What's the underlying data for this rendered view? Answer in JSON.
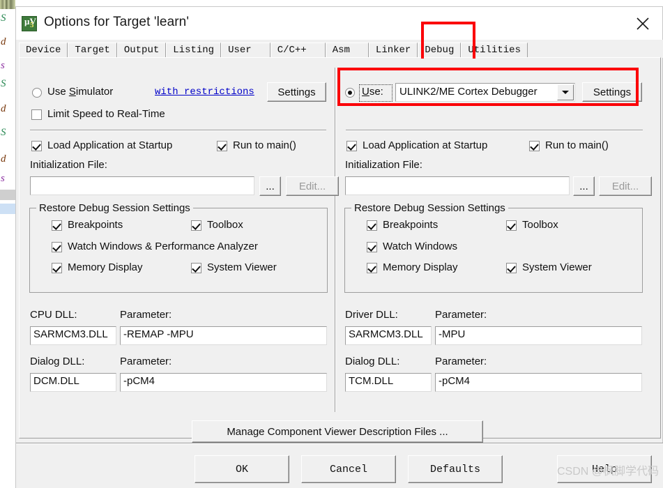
{
  "window": {
    "title": "Options for Target 'learn'",
    "app_icon": "keil-uvision-icon",
    "close_label": "✕"
  },
  "tabs": [
    {
      "label": "Device",
      "active": false
    },
    {
      "label": "Target",
      "active": false
    },
    {
      "label": "Output",
      "active": false
    },
    {
      "label": "Listing",
      "active": false
    },
    {
      "label": "User",
      "active": false
    },
    {
      "label": "C/C++",
      "active": false
    },
    {
      "label": "Asm",
      "active": false
    },
    {
      "label": "Linker",
      "active": false
    },
    {
      "label": "Debug",
      "active": true
    },
    {
      "label": "Utilities",
      "active": false
    }
  ],
  "left_panel": {
    "use_simulator": {
      "label": "Use Simulator",
      "accel": "S",
      "checked": false
    },
    "with_restrictions_link": "with restrictions",
    "settings_button": "Settings",
    "limit_speed": {
      "label": "Limit Speed to Real-Time",
      "checked": false
    },
    "load_application": {
      "label": "Load Application at Startup",
      "checked": true
    },
    "run_to_main": {
      "label": "Run to main()",
      "checked": true
    },
    "init_file_label": "Initialization File:",
    "init_file_value": "",
    "browse_button": "...",
    "edit_button": "Edit...",
    "restore_group": {
      "title": "Restore Debug Session Settings",
      "items": [
        {
          "label": "Breakpoints",
          "checked": true
        },
        {
          "label": "Toolbox",
          "checked": true
        },
        {
          "label": "Watch Windows & Performance Analyzer",
          "checked": true
        },
        {
          "label": "Memory Display",
          "checked": true
        },
        {
          "label": "System Viewer",
          "checked": true
        }
      ]
    },
    "cpu_dll_label": "CPU DLL:",
    "cpu_dll_value": "SARMCM3.DLL",
    "cpu_param_label": "Parameter:",
    "cpu_param_value": "-REMAP -MPU",
    "dialog_dll_label": "Dialog DLL:",
    "dialog_dll_value": "DCM.DLL",
    "dialog_param_label": "Parameter:",
    "dialog_param_value": "-pCM4"
  },
  "right_panel": {
    "use_radio": {
      "label": "Use:",
      "accel": "U",
      "checked": true
    },
    "debugger_selected": "ULINK2/ME Cortex Debugger",
    "settings_button": "Settings",
    "load_application": {
      "label": "Load Application at Startup",
      "checked": true
    },
    "run_to_main": {
      "label": "Run to main()",
      "checked": true
    },
    "init_file_label": "Initialization File:",
    "init_file_value": "",
    "browse_button": "...",
    "edit_button": "Edit...",
    "restore_group": {
      "title": "Restore Debug Session Settings",
      "items": [
        {
          "label": "Breakpoints",
          "checked": true
        },
        {
          "label": "Toolbox",
          "checked": true
        },
        {
          "label": "Watch Windows",
          "checked": true
        },
        {
          "label": "Memory Display",
          "checked": true
        },
        {
          "label": "System Viewer",
          "checked": true
        }
      ]
    },
    "driver_dll_label": "Driver DLL:",
    "driver_dll_value": "SARMCM3.DLL",
    "driver_param_label": "Parameter:",
    "driver_param_value": "-MPU",
    "dialog_dll_label": "Dialog DLL:",
    "dialog_dll_value": "TCM.DLL",
    "dialog_param_label": "Parameter:",
    "dialog_param_value": "-pCM4"
  },
  "manage_button": "Manage Component Viewer Description Files ...",
  "footer": {
    "ok": "OK",
    "cancel": "Cancel",
    "defaults": "Defaults",
    "help": "Help"
  },
  "annotations": {
    "accent_color": "#fb0007",
    "debug_tab_highlight": "Debug",
    "use_row_highlight": "ULINK2/ME Cortex Debugger"
  },
  "watermark": "CSDN @枫脚学代码",
  "background_editor": {
    "lines": [
      "S",
      "d",
      "s",
      "S",
      "d",
      "S",
      "d",
      "s"
    ]
  }
}
